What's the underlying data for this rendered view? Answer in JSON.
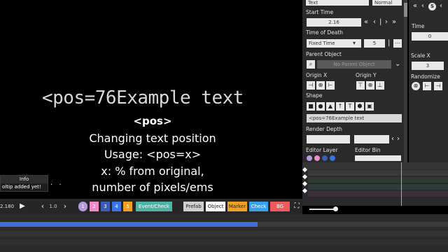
{
  "preview": {
    "code_text": "<pos=76Example text",
    "tip_title": "<pos>",
    "tip_lines": [
      "Changing text position",
      "Usage: <pos=x>",
      "x: % from original,",
      "number of pixels/ems"
    ],
    "dots": ". ."
  },
  "info_box": {
    "header": "Info",
    "body": "oltip added yet!"
  },
  "panel": {
    "top_left_field": "Text",
    "top_right_field": "Normal",
    "start_time_label": "Start Time",
    "start_time_value": "2.16",
    "time_of_death_label": "Time of Death",
    "time_of_death_mode": "Fixed Time",
    "time_of_death_value": "5",
    "parent_object_label": "Parent Object",
    "parent_object_value": "No Parent Object",
    "origin_x_label": "Origin X",
    "origin_y_label": "Origin Y",
    "shape_label": "Shape",
    "text_value": "<pos=76Example text",
    "render_depth_label": "Render Depth",
    "editor_layer_label": "Editor Layer",
    "editor_bin_label": "Editor Bin"
  },
  "panel2": {
    "time_label": "Time",
    "time_value": "0",
    "scale_x_label": "Scale X",
    "scale_x_value": "3",
    "randomize_label": "Randomize",
    "nav_left": "«",
    "nav_prev": "‹",
    "nav_badge": "S"
  },
  "toolbar": {
    "time_value": "2.180",
    "speed_value": "1.0",
    "layers": [
      "1",
      "2",
      "3",
      "4",
      "5"
    ],
    "event_check": "Event/Check",
    "prefab": "Prefab",
    "object": "Object",
    "marker": "Marker",
    "check": "Check",
    "bg": "BG"
  },
  "colors": {
    "layer1": "#b49be0",
    "layer2": "#f08ac8",
    "layer3": "#3b5bb5",
    "layer4": "#3a74e0",
    "layer5": "#f0a020",
    "event_check": "#4eb3a6",
    "marker": "#f0a020",
    "check": "#3aa0ea",
    "bg": "#f05a5a",
    "progress": "#3f6fd6"
  },
  "timeline_progress": 0.575
}
